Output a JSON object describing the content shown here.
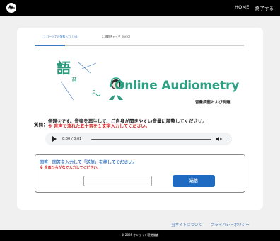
{
  "header": {
    "home": "HOME",
    "exit": "終了する"
  },
  "steps": {
    "step1": "1.パーソナル情報入力（2/4）",
    "step2": "2.聴取チェック（0/10）",
    "progress": 0.15
  },
  "hero": {
    "kanji_main": "語",
    "kanji_sub": "音",
    "title": "Online Audiometry",
    "subtitle": "音量調整および例題"
  },
  "question": {
    "label": "質問：",
    "text": "例題①です。音楽を再生して、ご自身が聞きやすい音量に調整してください。",
    "note": "※ 音声で流れた五十音を１文字入力してください。"
  },
  "audio": {
    "time": "0:00 / 0:01",
    "icons": [
      "play-icon",
      "volume-icon",
      "more-icon"
    ]
  },
  "answer": {
    "title": "回答：回答を入力して「送信」を押してください。",
    "note": "※ 全角ひらがなで入力してください。",
    "input_value": "",
    "submit": "送信"
  },
  "footer": {
    "link_about": "当サイトについて",
    "link_privacy": "プライバシーポリシー",
    "copyright": "© 2025 オンライン聴覚検査"
  },
  "colors": {
    "accent": "#3a78c2",
    "brand_green": "#2ba083",
    "warn": "#d62020",
    "submit": "#1f6bc1"
  }
}
